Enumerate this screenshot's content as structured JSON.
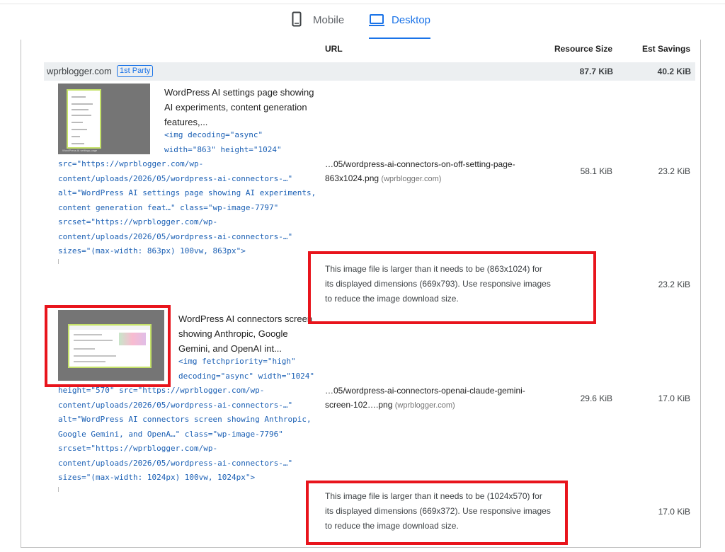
{
  "tabs": {
    "mobile": {
      "label": "Mobile",
      "icon": "mobile-phone-icon",
      "color": "#5f6368"
    },
    "desktop": {
      "label": "Desktop",
      "icon": "laptop-icon",
      "color": "#1a73e8",
      "active": true
    }
  },
  "table": {
    "headers": {
      "url": "URL",
      "resource_size": "Resource Size",
      "est_savings": "Est Savings"
    },
    "party": {
      "name": "wprblogger.com",
      "badge": "1st Party",
      "resource_size": "87.7 KiB",
      "est_savings": "40.2 KiB"
    },
    "items": [
      {
        "description": "WordPress AI settings page showing AI experiments, content generation features,...",
        "code_start": "<img decoding=\"async\"\nwidth=\"863\" height=\"1024\"",
        "code_rest": "src=\"https://wprblogger.com/wp-\ncontent/uploads/2026/05/wordpress-ai-connectors-…\"\nalt=\"WordPress AI settings page showing AI experiments,\ncontent generation feat…\" class=\"wp-image-7797\"\nsrcset=\"https://wprblogger.com/wp-\ncontent/uploads/2026/05/wordpress-ai-connectors-…\"\nsizes=\"(max-width: 863px) 100vw, 863px\">",
        "url_path": "…05/wordpress-ai-connectors-on-off-setting-page-863x1024.png",
        "url_host": "(wprblogger.com)",
        "resource_size": "58.1 KiB",
        "est_savings": "23.2 KiB",
        "sub_message": "This image file is larger than it needs to be (863x1024) for its displayed dimensions (669x793). Use responsive images to reduce the image download size.",
        "sub_savings": "23.2 KiB",
        "thumb_caption": "WordPress AI settings page"
      },
      {
        "description": "WordPress AI connectors screen showing Anthropic, Google Gemini, and OpenAI int...",
        "code_start": "<img fetchpriority=\"high\"\ndecoding=\"async\" width=\"1024\"",
        "code_rest": "height=\"570\" src=\"https://wprblogger.com/wp-\ncontent/uploads/2026/05/wordpress-ai-connectors-…\"\nalt=\"WordPress AI connectors screen showing Anthropic,\nGoogle Gemini, and OpenA…\" class=\"wp-image-7796\"\nsrcset=\"https://wprblogger.com/wp-\ncontent/uploads/2026/05/wordpress-ai-connectors-…\"\nsizes=\"(max-width: 1024px) 100vw, 1024px\">",
        "url_path": "…05/wordpress-ai-connectors-openai-claude-gemini-screen-102….png",
        "url_host": "(wprblogger.com)",
        "resource_size": "29.6 KiB",
        "est_savings": "17.0 KiB",
        "sub_message": "This image file is larger than it needs to be (1024x570) for its displayed dimensions (669x372). Use responsive images to reduce the image download size.",
        "sub_savings": "17.0 KiB"
      }
    ]
  },
  "highlight_color": "#e8141c"
}
